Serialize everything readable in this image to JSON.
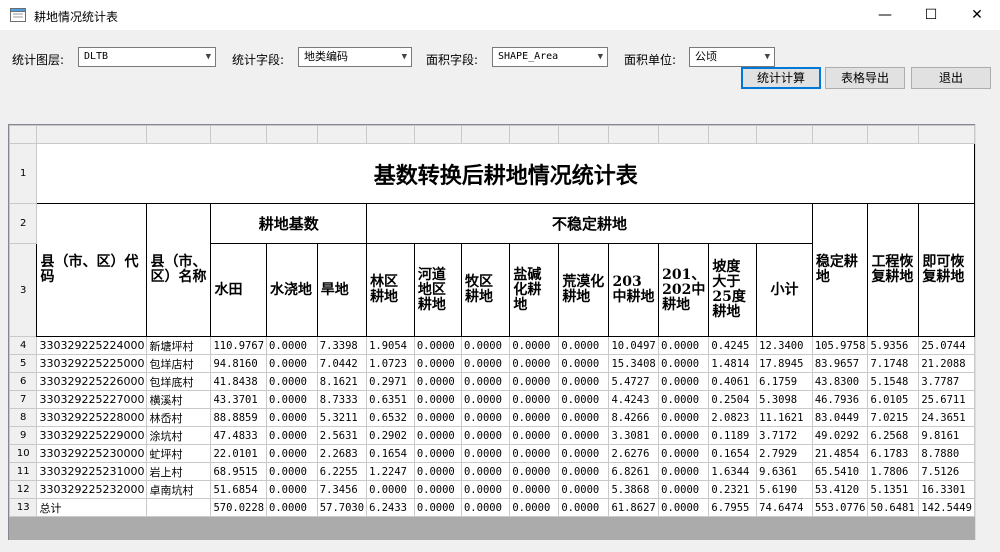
{
  "window": {
    "title": "耕地情况统计表",
    "min": "—",
    "max": "☐",
    "close": "✕"
  },
  "toolbar": {
    "layer_label": "统计图层:",
    "layer_value": "DLTB",
    "field_label": "统计字段:",
    "field_value": "地类编码",
    "area_label": "面积字段:",
    "area_value": "SHAPE_Area",
    "unit_label": "面积单位:",
    "unit_value": "公顷",
    "calc_button": "统计计算",
    "export_button": "表格导出",
    "exit_button": "退出"
  },
  "sheet": {
    "title": "基数转换后耕地情况统计表",
    "row_numbers": [
      "1",
      "2",
      "3",
      "4",
      "5",
      "6",
      "7",
      "8",
      "9",
      "10",
      "11",
      "12",
      "13"
    ],
    "group_headers": {
      "base": "耕地基数",
      "unstable": "不稳定耕地"
    },
    "headers": {
      "county_code": "县（市、区）代码",
      "county_name": "县（市、区）名称",
      "paddy": "水田",
      "irrigated": "水浇地",
      "dry": "旱地",
      "forest": "林区耕地",
      "river": "河道地区耕地",
      "pasture": "牧区耕地",
      "saline": "盐碱化耕地",
      "desert": "荒漠化耕地",
      "c203": "203中耕地",
      "c201": "201、202中耕地",
      "slope": "坡度大于25度耕地",
      "subtotal": "小计",
      "stable": "稳定耕地",
      "engineering": "工程恢复耕地",
      "immediate": "即可恢复耕地"
    },
    "rows": [
      [
        "330329225224000",
        "新塘坪村",
        "110.9767",
        "0.0000",
        "7.3398",
        "1.9054",
        "0.0000",
        "0.0000",
        "0.0000",
        "0.0000",
        "10.0497",
        "0.0000",
        "0.4245",
        "12.3400",
        "105.9758",
        "5.9356",
        "25.0744"
      ],
      [
        "330329225225000",
        "包垟店村",
        "94.8160",
        "0.0000",
        "7.0442",
        "1.0723",
        "0.0000",
        "0.0000",
        "0.0000",
        "0.0000",
        "15.3408",
        "0.0000",
        "1.4814",
        "17.8945",
        "83.9657",
        "7.1748",
        "21.2088"
      ],
      [
        "330329225226000",
        "包垟底村",
        "41.8438",
        "0.0000",
        "8.1621",
        "0.2971",
        "0.0000",
        "0.0000",
        "0.0000",
        "0.0000",
        "5.4727",
        "0.0000",
        "0.4061",
        "6.1759",
        "43.8300",
        "5.1548",
        "3.7787"
      ],
      [
        "330329225227000",
        "横溪村",
        "43.3701",
        "0.0000",
        "8.7333",
        "0.6351",
        "0.0000",
        "0.0000",
        "0.0000",
        "0.0000",
        "4.4243",
        "0.0000",
        "0.2504",
        "5.3098",
        "46.7936",
        "6.0105",
        "25.6711"
      ],
      [
        "330329225228000",
        "林岙村",
        "88.8859",
        "0.0000",
        "5.3211",
        "0.6532",
        "0.0000",
        "0.0000",
        "0.0000",
        "0.0000",
        "8.4266",
        "0.0000",
        "2.0823",
        "11.1621",
        "83.0449",
        "7.0215",
        "24.3651"
      ],
      [
        "330329225229000",
        "涂坑村",
        "47.4833",
        "0.0000",
        "2.5631",
        "0.2902",
        "0.0000",
        "0.0000",
        "0.0000",
        "0.0000",
        "3.3081",
        "0.0000",
        "0.1189",
        "3.7172",
        "49.0292",
        "6.2568",
        "9.8161"
      ],
      [
        "330329225230000",
        "虻坪村",
        "22.0101",
        "0.0000",
        "2.2683",
        "0.1654",
        "0.0000",
        "0.0000",
        "0.0000",
        "0.0000",
        "2.6276",
        "0.0000",
        "0.1654",
        "2.7929",
        "21.4854",
        "6.1783",
        "8.7880"
      ],
      [
        "330329225231000",
        "岩上村",
        "68.9515",
        "0.0000",
        "6.2255",
        "1.2247",
        "0.0000",
        "0.0000",
        "0.0000",
        "0.0000",
        "6.8261",
        "0.0000",
        "1.6344",
        "9.6361",
        "65.5410",
        "1.7806",
        "7.5126"
      ],
      [
        "330329225232000",
        "卓南坑村",
        "51.6854",
        "0.0000",
        "7.3456",
        "0.0000",
        "0.0000",
        "0.0000",
        "0.0000",
        "0.0000",
        "5.3868",
        "0.0000",
        "0.2321",
        "5.6190",
        "53.4120",
        "5.1351",
        "16.3301"
      ],
      [
        "总计",
        "",
        "570.0228",
        "0.0000",
        "57.7030",
        "6.2433",
        "0.0000",
        "0.0000",
        "0.0000",
        "0.0000",
        "61.8627",
        "0.0000",
        "6.7955",
        "74.6474",
        "553.0776",
        "50.6481",
        "142.5449"
      ]
    ]
  }
}
